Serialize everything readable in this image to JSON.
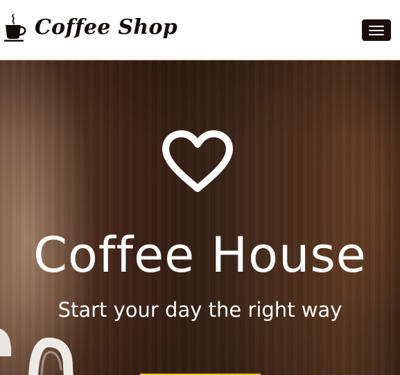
{
  "navbar": {
    "brand_text": "Coffee Shop",
    "brand_icon": "coffee-cup-icon",
    "menu_toggle_icon": "hamburger-menu-icon"
  },
  "hero": {
    "icon": "heart-outline-icon",
    "title": "Coffee House",
    "subtitle": "Start your day the right way"
  },
  "colors": {
    "nav_background": "#ffffff",
    "brand_text": "#140c08",
    "toggle_background": "#1b0d08",
    "hero_text": "#ffffff",
    "accent": "#f2c11b"
  }
}
